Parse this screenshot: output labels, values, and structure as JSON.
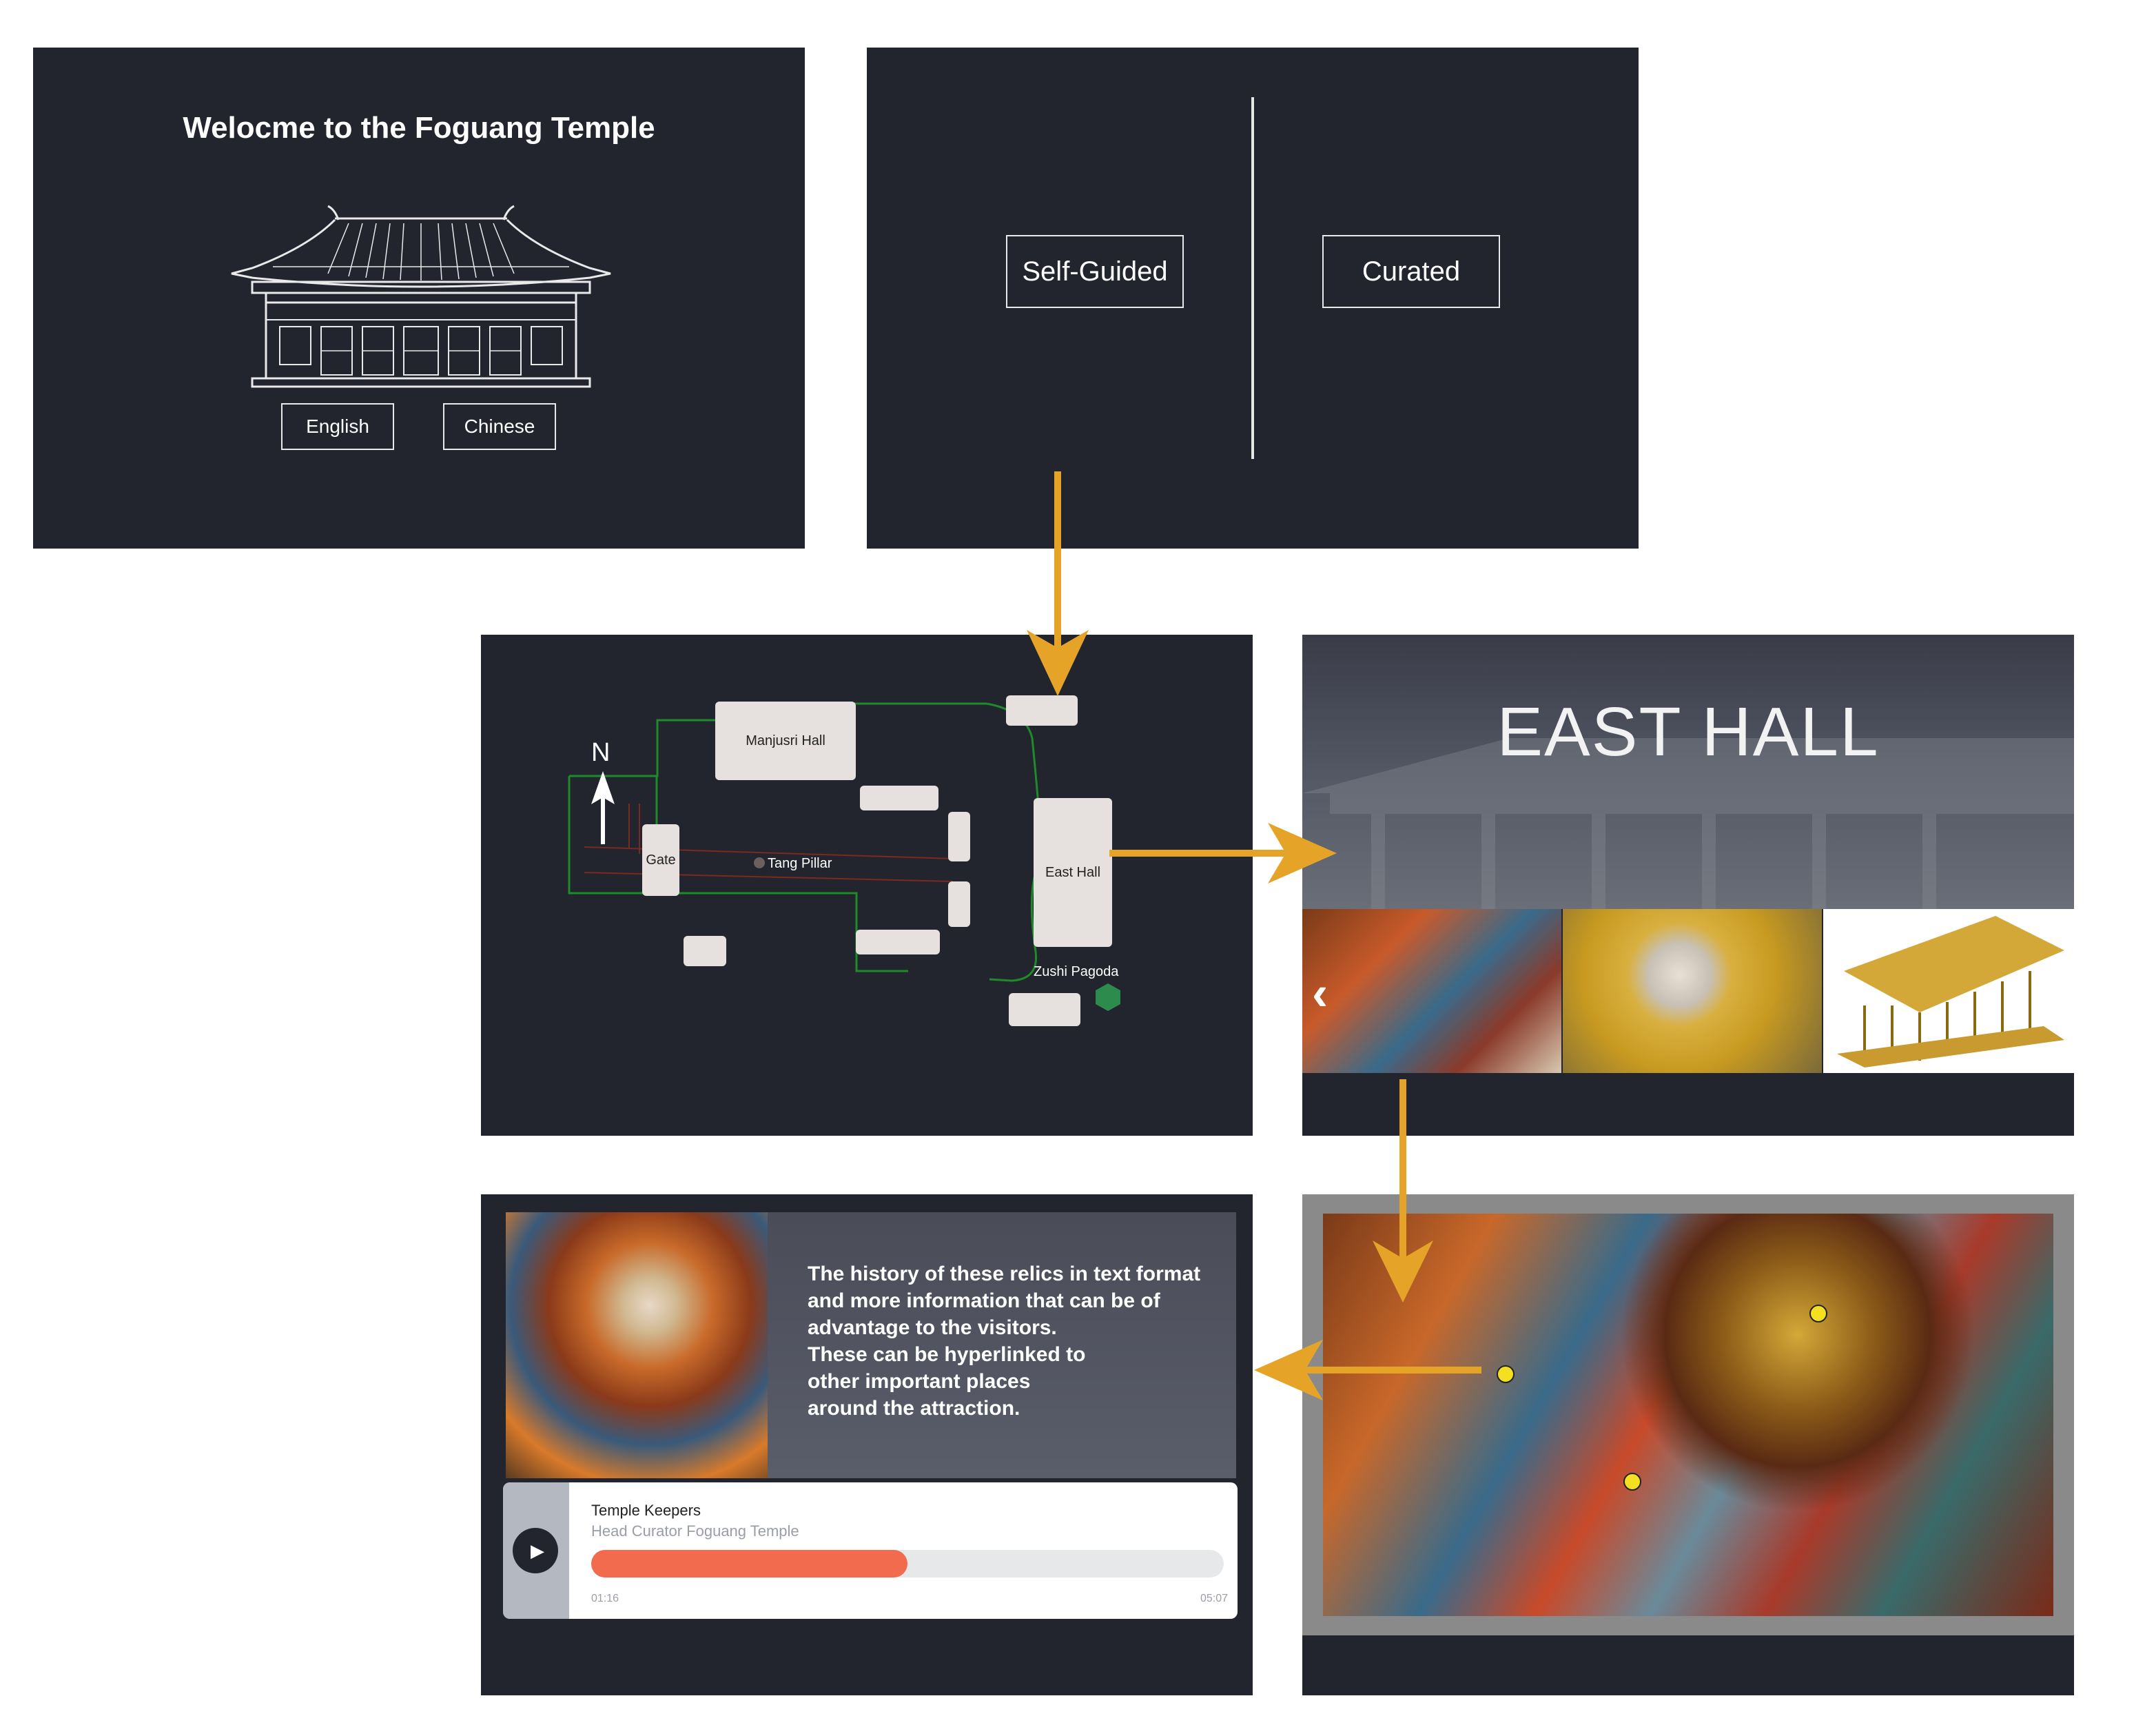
{
  "welcome": {
    "title": "Welocme to the Foguang Temple",
    "english_label": "English",
    "chinese_label": "Chinese"
  },
  "mode": {
    "self_guided_label": "Self-Guided",
    "curated_label": "Curated"
  },
  "map": {
    "north_label": "N",
    "manjusri_label": "Manjusri Hall",
    "gate_label": "Gate",
    "tang_pillar_label": "Tang Pillar",
    "east_hall_label": "East Hall",
    "zushi_pagoda_label": "Zushi Pagoda"
  },
  "hall": {
    "title": "EAST HALL"
  },
  "info": {
    "text_lines": [
      "The history of these relics in text format",
      "and more information that can be of",
      "advantage to the visitors.",
      "These can be hyperlinked to",
      "other important places",
      "around the attraction."
    ],
    "audio": {
      "title": "Temple Keepers",
      "subtitle": "Head Curator Foguang Temple",
      "current_time": "01:16",
      "total_time": "05:07",
      "progress": 0.5
    }
  },
  "colors": {
    "panel_bg": "#22242e",
    "arrow": "#e5a428",
    "path_green": "#1f8a2a",
    "progress": "#f26b4f",
    "pagoda": "#2e8b4e"
  }
}
